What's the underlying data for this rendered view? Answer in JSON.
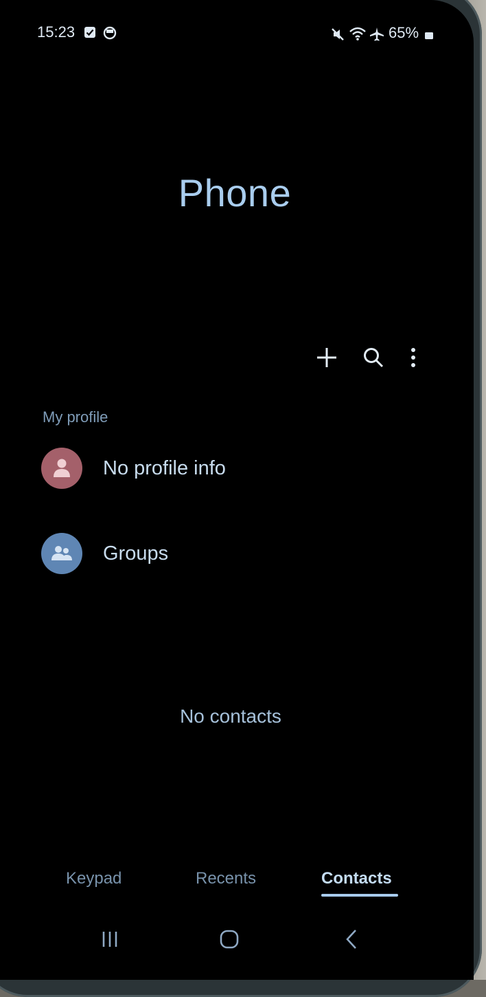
{
  "status_bar": {
    "time": "15:23",
    "battery": "65%",
    "icons": [
      "task-check-icon",
      "messenger-icon",
      "mute-icon",
      "wifi-icon",
      "airplane-icon",
      "battery-icon"
    ]
  },
  "app": {
    "title": "Phone"
  },
  "toolbar": {
    "icons": [
      "plus-icon",
      "search-icon",
      "more-vert-icon"
    ]
  },
  "profile_section": {
    "label": "My profile",
    "profile_text": "No profile info",
    "groups_text": "Groups"
  },
  "contacts": {
    "empty_text": "No contacts"
  },
  "tabs": [
    {
      "label": "Keypad",
      "active": false
    },
    {
      "label": "Recents",
      "active": false
    },
    {
      "label": "Contacts",
      "active": true
    }
  ],
  "nav_bar": {
    "icons": [
      "recent-apps-icon",
      "home-icon",
      "back-icon"
    ]
  },
  "colors": {
    "accent": "#a8cbed",
    "profile_avatar": "#a4606a",
    "groups_avatar": "#5f86b4"
  }
}
